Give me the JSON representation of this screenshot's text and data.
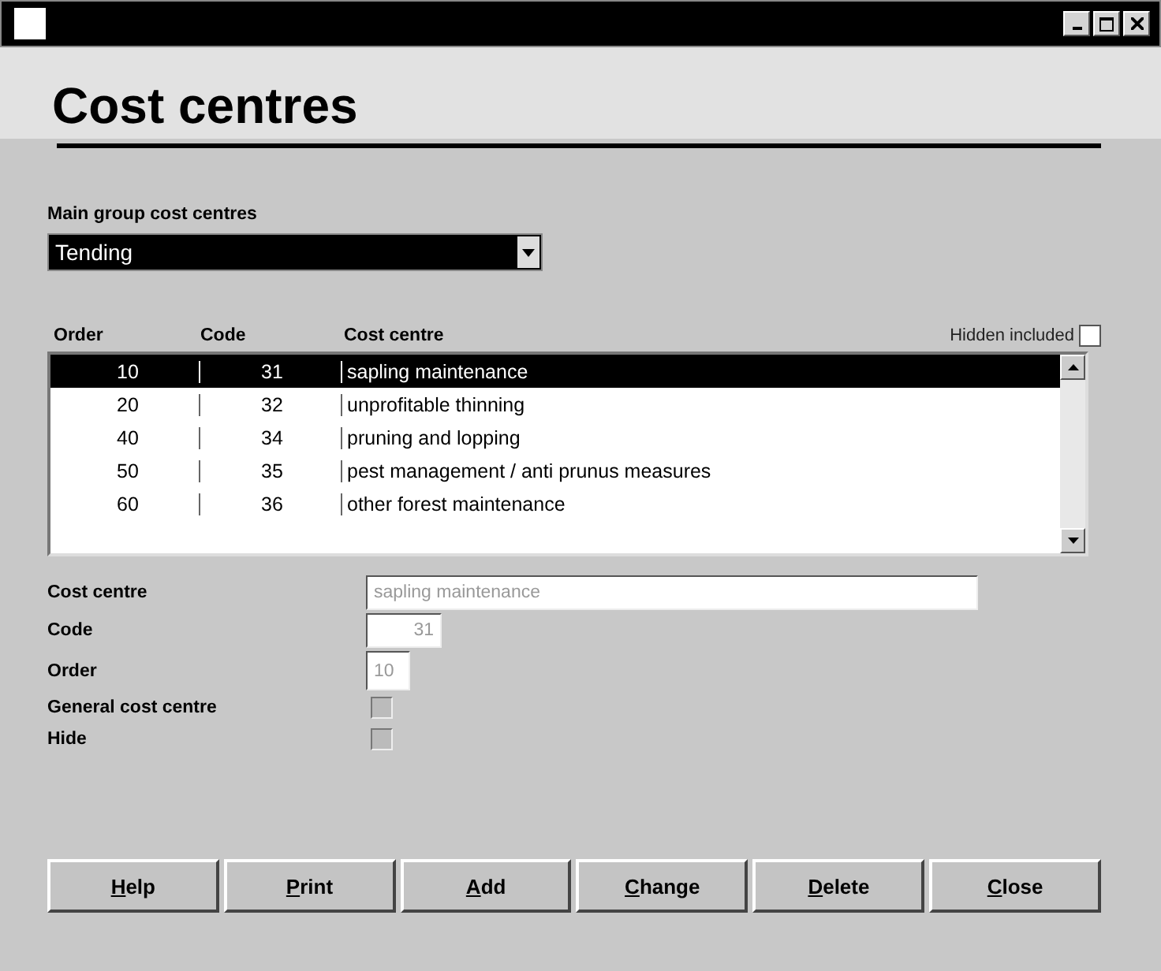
{
  "heading": "Cost centres",
  "main_group": {
    "label": "Main group cost centres",
    "value": "Tending"
  },
  "table": {
    "columns": [
      "Order",
      "Code",
      "Cost centre"
    ],
    "hidden_included": {
      "label": "Hidden included",
      "checked": false
    },
    "rows": [
      {
        "order": "10",
        "code": "31",
        "name": "sapling maintenance",
        "selected": true
      },
      {
        "order": "20",
        "code": "32",
        "name": "unprofitable thinning",
        "selected": false
      },
      {
        "order": "40",
        "code": "34",
        "name": "pruning and lopping",
        "selected": false
      },
      {
        "order": "50",
        "code": "35",
        "name": "pest management / anti prunus measures",
        "selected": false
      },
      {
        "order": "60",
        "code": "36",
        "name": "other forest maintenance",
        "selected": false
      }
    ]
  },
  "form": [
    {
      "kind": "text",
      "label": "Cost centre",
      "value": "sapling maintenance",
      "disabled": true
    },
    {
      "kind": "number",
      "label": "Code",
      "value": "31",
      "disabled": true
    },
    {
      "kind": "short",
      "label": "Order",
      "value": "10",
      "disabled": true
    },
    {
      "kind": "checkbox",
      "label": "General cost centre",
      "checked": false,
      "disabled": true
    },
    {
      "kind": "checkbox",
      "label": "Hide",
      "checked": false,
      "disabled": true
    }
  ],
  "buttons": [
    {
      "key": "H",
      "rest": "elp"
    },
    {
      "key": "P",
      "rest": "rint"
    },
    {
      "key": "A",
      "rest": "dd"
    },
    {
      "key": "C",
      "rest": "hange"
    },
    {
      "key": "D",
      "rest": "elete"
    },
    {
      "key": "C",
      "rest": "lose"
    }
  ]
}
